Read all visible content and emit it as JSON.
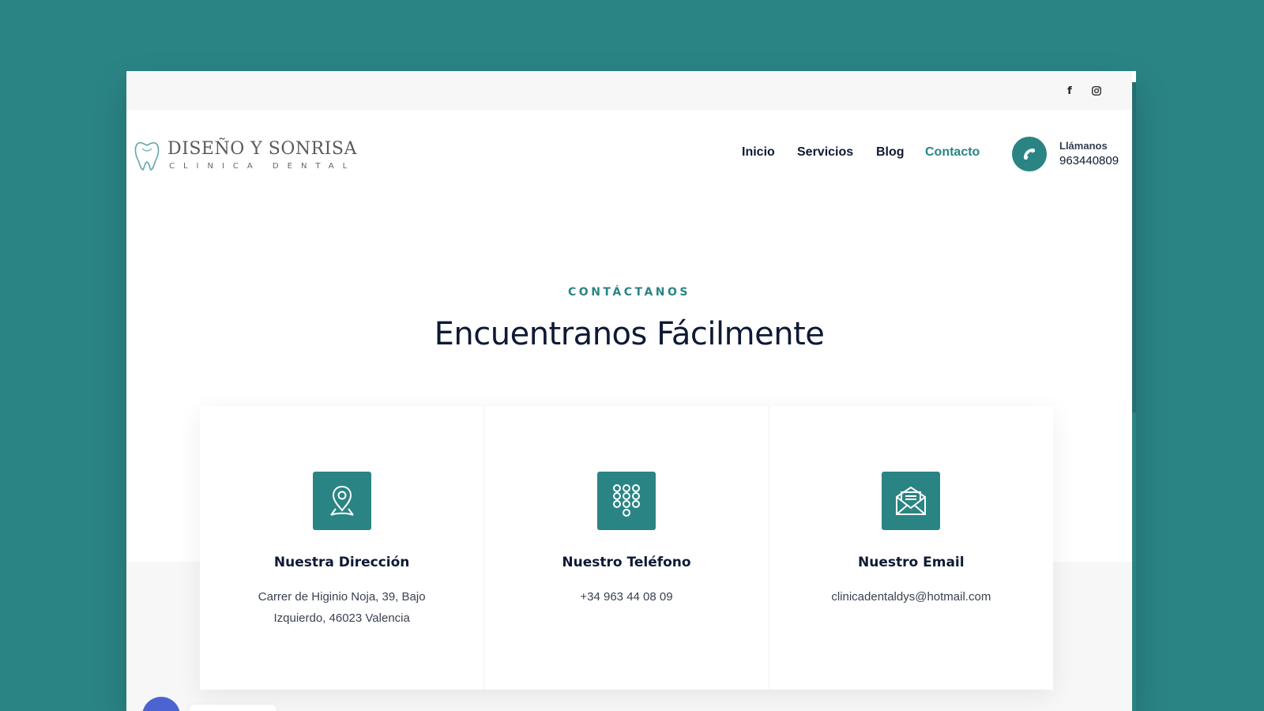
{
  "brand": {
    "name": "DISEÑO Y SONRISA",
    "tagline": "CLINICA DENTAL"
  },
  "topbar": {
    "social": [
      {
        "icon": "facebook-icon",
        "glyph": "f"
      },
      {
        "icon": "instagram-icon",
        "glyph": "◎"
      }
    ]
  },
  "nav": {
    "items": [
      {
        "label": "Inicio",
        "active": false
      },
      {
        "label": "Servicios",
        "active": false
      },
      {
        "label": "Blog",
        "active": false
      },
      {
        "label": "Contacto",
        "active": true
      }
    ]
  },
  "call": {
    "label": "Llámanos",
    "number": "963440809",
    "icon": "phone-icon"
  },
  "section": {
    "eyebrow": "CONTÁCTANOS",
    "title": "Encuentranos Fácilmente"
  },
  "cards": [
    {
      "icon": "location-pin-icon",
      "title": "Nuestra Dirección",
      "text": "Carrer de Higinio Noja, 39, Bajo Izquierdo, 46023 Valencia"
    },
    {
      "icon": "keypad-icon",
      "title": "Nuestro Teléfono",
      "text": "+34 963 44 08 09"
    },
    {
      "icon": "envelope-icon",
      "title": "Nuestro Email",
      "text": "clinicadentaldys@hotmail.com"
    }
  ],
  "colors": {
    "accent": "#2b8484",
    "heading": "#0e1a34",
    "chat": "#4c63d2"
  }
}
